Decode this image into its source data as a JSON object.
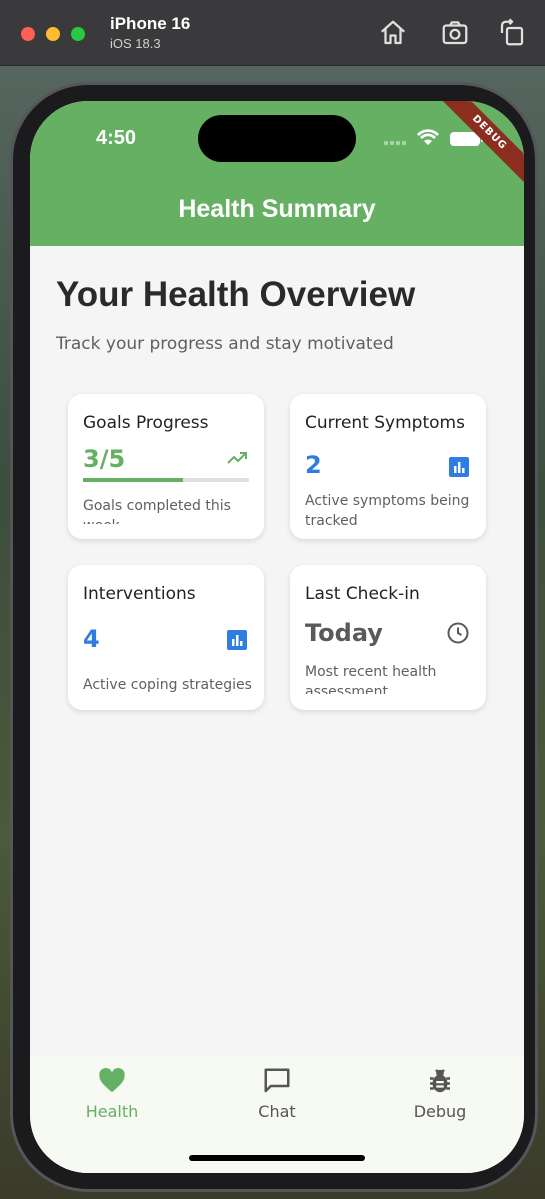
{
  "simulator": {
    "device_name": "iPhone 16",
    "os_version": "iOS 18.3"
  },
  "status_bar": {
    "time": "4:50",
    "debug_banner": "DEBUG"
  },
  "app_bar": {
    "title": "Health Summary"
  },
  "main": {
    "title": "Your Health Overview",
    "subtitle": "Track your progress and stay motivated",
    "cards": [
      {
        "title": "Goals Progress",
        "value": "3/5",
        "description": "Goals completed this week",
        "icon": "trending-up-icon",
        "progress": 0.6,
        "value_color": "#66b064"
      },
      {
        "title": "Current Symptoms",
        "value": "2",
        "description": "Active symptoms being tracked",
        "icon": "bar-chart-icon",
        "value_color": "#2f7de1"
      },
      {
        "title": "Interventions",
        "value": "4",
        "description": "Active coping strategies",
        "icon": "bar-chart-icon",
        "value_color": "#2f7de1"
      },
      {
        "title": "Last Check-in",
        "value": "Today",
        "description": "Most recent health assessment",
        "icon": "clock-icon",
        "value_color": "#5a5a5a"
      }
    ]
  },
  "bottom_nav": {
    "items": [
      {
        "label": "Health",
        "icon": "heart-icon",
        "active": true
      },
      {
        "label": "Chat",
        "icon": "chat-bubble-icon",
        "active": false
      },
      {
        "label": "Debug",
        "icon": "bug-icon",
        "active": false
      }
    ],
    "active_color": "#66b064",
    "inactive_color": "#555555"
  },
  "colors": {
    "primary": "#66b064",
    "accent_blue": "#2f7de1",
    "background": "#f5f5f5"
  }
}
